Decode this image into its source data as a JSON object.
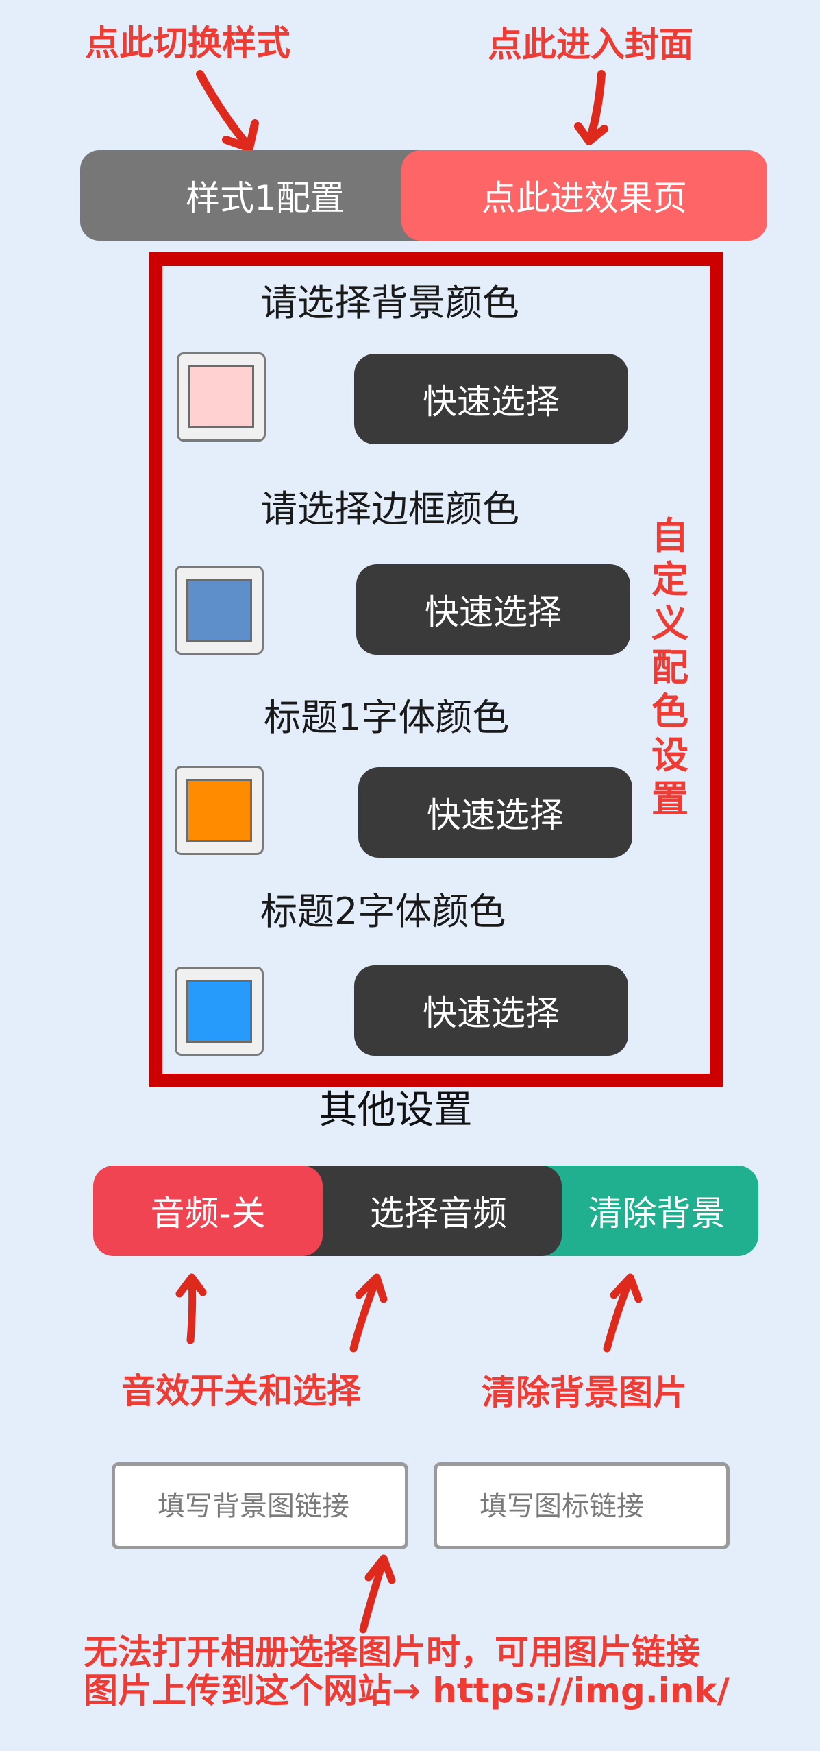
{
  "annotations": {
    "switch_style": "点此切换样式",
    "enter_cover": "点此进入封面",
    "custom_color": [
      "自",
      "定",
      "义",
      "配",
      "色",
      "设",
      "置"
    ],
    "audio_toggle": "音效开关和选择",
    "clear_bg": "清除背景图片",
    "footer_line1": "无法打开相册选择图片时，可用图片链接",
    "footer_line2": "图片上传到这个网站→ https://img.ink/"
  },
  "toolbar": {
    "style_label": "样式1配置",
    "effect_label": "点此进效果页"
  },
  "color_settings": [
    {
      "label": "请选择背景颜色",
      "color": "#ffd1d1",
      "button": "快速选择"
    },
    {
      "label": "请选择边框颜色",
      "color": "#5e8fcb",
      "button": "快速选择"
    },
    {
      "label": "标题1字体颜色",
      "color": "#ff8c00",
      "button": "快速选择"
    },
    {
      "label": "标题2字体颜色",
      "color": "#279bfc",
      "button": "快速选择"
    }
  ],
  "other": {
    "title": "其他设置",
    "audio_label": "音频-关",
    "choose_audio_label": "选择音频",
    "clear_bg_label": "清除背景"
  },
  "inputs": {
    "bg_link_placeholder": "填写背景图链接",
    "icon_link_placeholder": "填写图标链接"
  },
  "colors": {
    "accent_red": "#fd6567",
    "frame_red": "#cc0000",
    "annotation_red": "#ee3c34",
    "dark_button": "#3a3a3a",
    "teal": "#20af8f"
  }
}
